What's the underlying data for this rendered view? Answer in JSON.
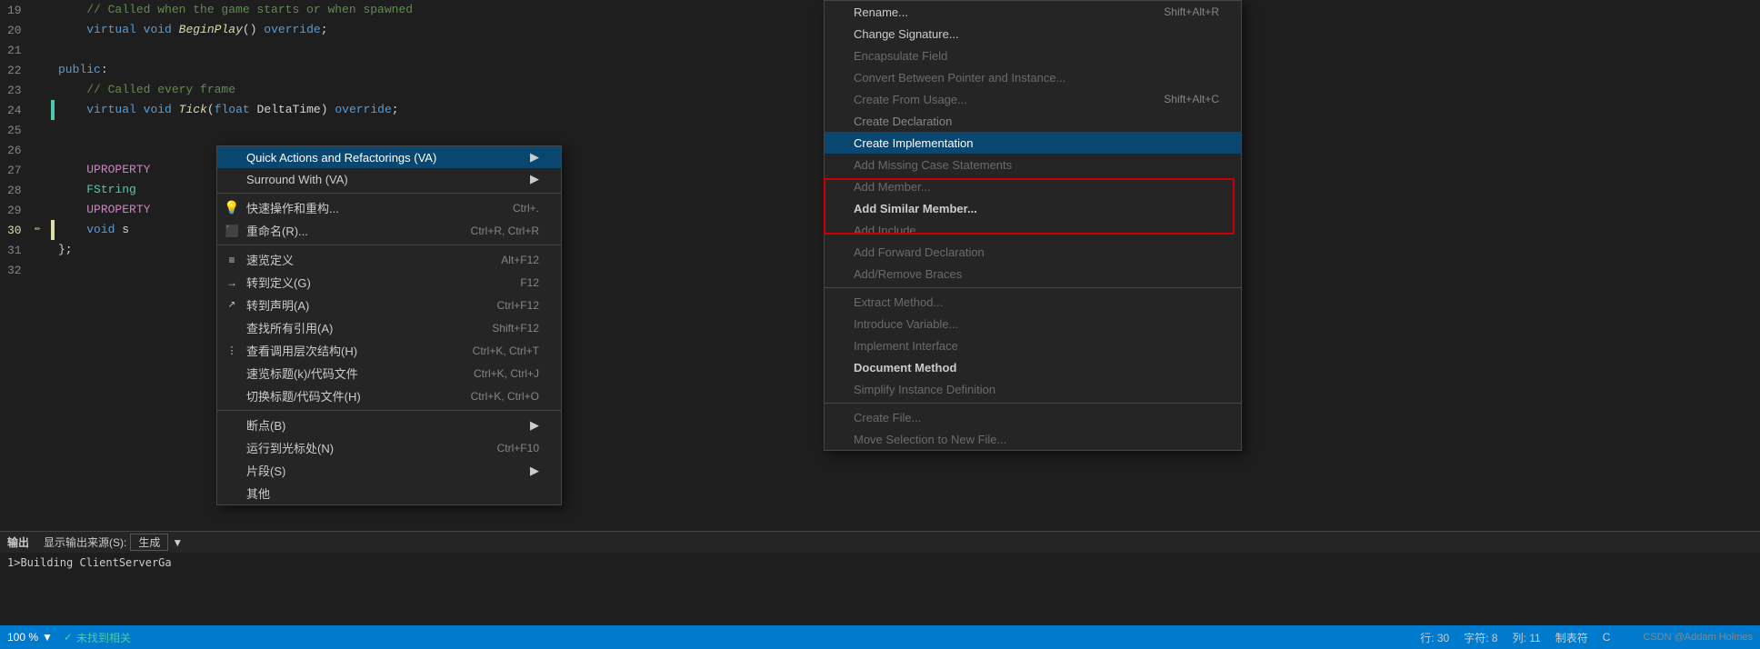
{
  "editor": {
    "lines": [
      {
        "num": "19",
        "content": "    // Called when the game starts or when spawned",
        "type": "comment"
      },
      {
        "num": "20",
        "content": "    virtual void BeginPlay() override;",
        "type": "code"
      },
      {
        "num": "21",
        "content": "",
        "type": "empty"
      },
      {
        "num": "22",
        "content": "public:",
        "type": "code"
      },
      {
        "num": "23",
        "content": "    // Called every frame",
        "type": "comment"
      },
      {
        "num": "24",
        "content": "    virtual void Tick(float DeltaTime) override;",
        "type": "code"
      },
      {
        "num": "25",
        "content": "",
        "type": "empty"
      },
      {
        "num": "26",
        "content": "",
        "type": "empty"
      },
      {
        "num": "27",
        "content": "    UPROPERTY",
        "type": "code"
      },
      {
        "num": "28",
        "content": "    FString",
        "type": "code"
      },
      {
        "num": "29",
        "content": "    UPROPERTY",
        "type": "code"
      },
      {
        "num": "30",
        "content": "    void s",
        "type": "code"
      },
      {
        "num": "31",
        "content": "};",
        "type": "code"
      },
      {
        "num": "32",
        "content": "",
        "type": "empty"
      }
    ]
  },
  "context_menu_main": {
    "items": [
      {
        "label": "Quick Actions and Refactorings (VA)",
        "shortcut": "",
        "has_arrow": true,
        "active": true,
        "icon": ""
      },
      {
        "label": "Surround With (VA)",
        "shortcut": "",
        "has_arrow": true,
        "icon": ""
      },
      {
        "label": "快速操作和重构...",
        "shortcut": "Ctrl+.",
        "icon": "lightbulb"
      },
      {
        "label": "重命名(R)...",
        "shortcut": "Ctrl+R, Ctrl+R",
        "icon": "rename"
      },
      {
        "label": "速览定义",
        "shortcut": "Alt+F12",
        "icon": "peek"
      },
      {
        "label": "转到定义(G)",
        "shortcut": "F12",
        "icon": "goto"
      },
      {
        "label": "转到声明(A)",
        "shortcut": "Ctrl+F12",
        "icon": "decl"
      },
      {
        "label": "查找所有引用(A)",
        "shortcut": "Shift+F12",
        "icon": ""
      },
      {
        "label": "查看调用层次结构(H)",
        "shortcut": "Ctrl+K, Ctrl+T",
        "icon": "hierarchy"
      },
      {
        "label": "速览标题(k)/代码文件",
        "shortcut": "Ctrl+K, Ctrl+J",
        "icon": ""
      },
      {
        "label": "切换标题/代码文件(H)",
        "shortcut": "Ctrl+K, Ctrl+O",
        "icon": ""
      },
      {
        "label": "断点(B)",
        "shortcut": "",
        "has_arrow": true,
        "icon": ""
      },
      {
        "label": "运行到光标处(N)",
        "shortcut": "Ctrl+F10",
        "icon": ""
      },
      {
        "label": "片段(S)",
        "shortcut": "",
        "has_arrow": true,
        "icon": ""
      }
    ]
  },
  "context_menu_right": {
    "items": [
      {
        "label": "Rename...",
        "shortcut": "Shift+Alt+R",
        "disabled": false
      },
      {
        "label": "Change Signature...",
        "shortcut": "",
        "disabled": false
      },
      {
        "label": "Encapsulate Field",
        "shortcut": "",
        "disabled": true
      },
      {
        "label": "Convert Between Pointer and Instance...",
        "shortcut": "",
        "disabled": true
      },
      {
        "label": "Create From Usage...",
        "shortcut": "Shift+Alt+C",
        "disabled": true
      },
      {
        "label": "Create Declaration",
        "shortcut": "",
        "disabled": false,
        "highlighted": true
      },
      {
        "label": "Create Implementation",
        "shortcut": "",
        "disabled": false,
        "highlighted": true,
        "active": true
      },
      {
        "label": "Add Missing Case Statements",
        "shortcut": "",
        "disabled": true
      },
      {
        "label": "Add Member...",
        "shortcut": "",
        "disabled": true
      },
      {
        "label": "Add Similar Member...",
        "shortcut": "",
        "disabled": false,
        "bold": true
      },
      {
        "label": "Add Include",
        "shortcut": "",
        "disabled": true
      },
      {
        "label": "Add Forward Declaration",
        "shortcut": "",
        "disabled": true
      },
      {
        "label": "Add/Remove Braces",
        "shortcut": "",
        "disabled": true
      },
      {
        "label": "Extract Method...",
        "shortcut": "",
        "disabled": true
      },
      {
        "label": "Introduce Variable...",
        "shortcut": "",
        "disabled": true
      },
      {
        "label": "Implement Interface",
        "shortcut": "",
        "disabled": true
      },
      {
        "label": "Document Method",
        "shortcut": "",
        "disabled": false,
        "bold": true
      },
      {
        "label": "Simplify Instance Definition",
        "shortcut": "",
        "disabled": true
      },
      {
        "label": "Create File...",
        "shortcut": "",
        "disabled": true
      },
      {
        "label": "Move Selection to New File...",
        "shortcut": "",
        "disabled": true
      }
    ]
  },
  "status_bar": {
    "zoom": "100 %",
    "check_label": "未找到相关",
    "position": "行: 30",
    "chars": "字符: 8",
    "col": "列: 11",
    "tab": "制表符",
    "encoding": "C"
  },
  "output_panel": {
    "title": "输出",
    "source_label": "显示输出来源(S):",
    "source_value": "生成",
    "content": "1>Building ClientServerGa"
  },
  "branding": {
    "watermark": "CSDN @Addam Holmes"
  }
}
